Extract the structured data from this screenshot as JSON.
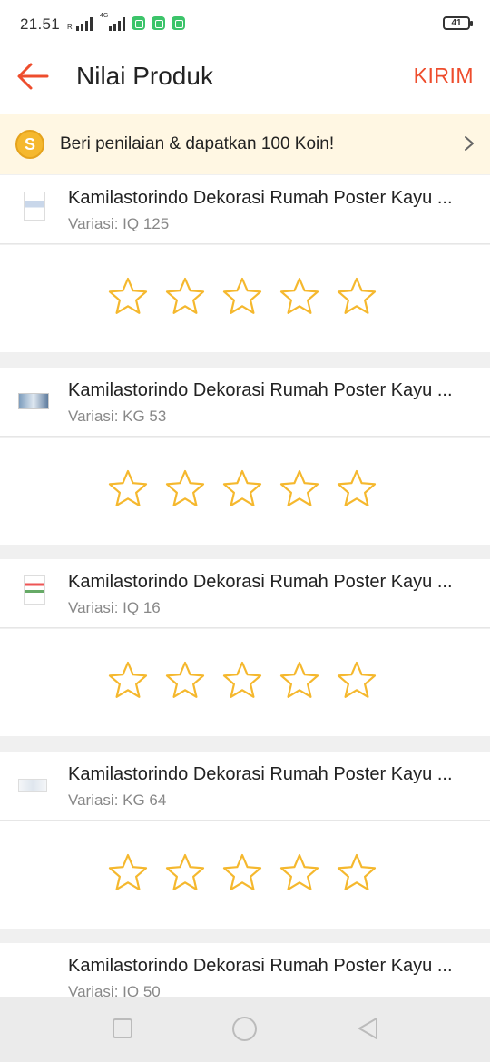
{
  "status_bar": {
    "time": "21.51",
    "network": "4G",
    "roaming": "R",
    "battery": "41"
  },
  "header": {
    "title": "Nilai Produk",
    "submit_label": "KIRIM"
  },
  "coin_banner": {
    "coin_symbol": "S",
    "text": "Beri penilaian & dapatkan 100 Koin!"
  },
  "products": [
    {
      "name": "Kamilastorindo Dekorasi Rumah Poster Kayu ...",
      "variation": "Variasi: IQ 125"
    },
    {
      "name": "Kamilastorindo Dekorasi Rumah Poster Kayu ...",
      "variation": "Variasi: KG 53"
    },
    {
      "name": "Kamilastorindo Dekorasi Rumah Poster Kayu ...",
      "variation": "Variasi: IQ 16"
    },
    {
      "name": "Kamilastorindo Dekorasi Rumah Poster Kayu ...",
      "variation": "Variasi: KG 64"
    },
    {
      "name": "Kamilastorindo Dekorasi Rumah Poster Kayu ...",
      "variation": "Variasi: IQ 50"
    }
  ],
  "rating": {
    "max_stars": 5,
    "selected_stars": 0
  },
  "colors": {
    "accent": "#ee4d2d",
    "star": "#f5b82e",
    "banner_bg": "#fff7e3"
  }
}
